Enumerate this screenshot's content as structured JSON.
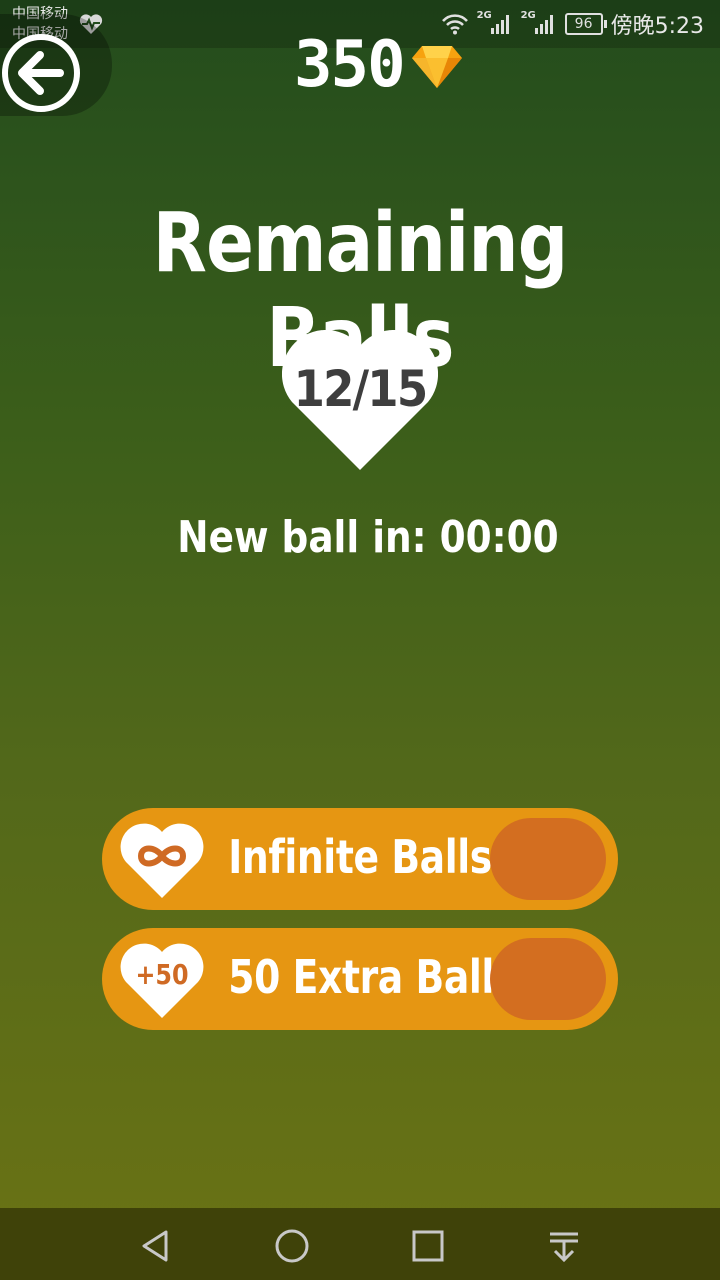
{
  "status_bar": {
    "carrier_1": "中国移动",
    "carrier_2": "中国移动",
    "network_1": "2G",
    "network_2": "2G",
    "battery": "96",
    "time": "傍晚5:23"
  },
  "header": {
    "gem_count": "350",
    "gem_icon": "diamond-icon",
    "back_icon": "back-arrow-icon"
  },
  "main": {
    "title": "Remaining Balls",
    "balls_count": "12/15",
    "timer_text": "New ball in: 00:00"
  },
  "offers": [
    {
      "label": "Infinite Balls",
      "icon": "infinity-icon",
      "icon_text": "∞"
    },
    {
      "label": "50 Extra Balls",
      "icon": "plus-50-icon",
      "icon_text": "+50"
    }
  ],
  "nav": {
    "back": "back-triangle-icon",
    "home": "home-circle-icon",
    "recents": "recents-square-icon",
    "notifications": "pull-down-icon"
  },
  "colors": {
    "accent": "#e69612",
    "price_pill": "#d36e20",
    "heart_text": "#3e3e3e"
  }
}
